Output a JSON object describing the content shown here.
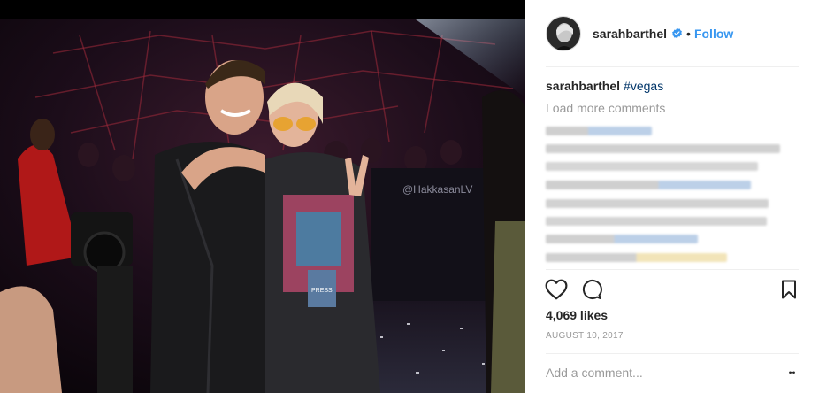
{
  "post": {
    "username": "sarahbarthel",
    "separator": "•",
    "follow_label": "Follow",
    "caption_user": "sarahbarthel",
    "caption_tag": "#vegas",
    "load_more": "Load more comments",
    "likes": "4,069 likes",
    "date": "AUGUST 10, 2017",
    "comment_placeholder": "Add a comment...",
    "more_options": "•••",
    "photo_sign_text": "@HakkasanLV",
    "photo_badge_text": "PRESS"
  },
  "icons": {
    "verified": "verified-badge-icon",
    "like": "heart-icon",
    "comment": "comment-bubble-icon",
    "save": "bookmark-icon"
  },
  "colors": {
    "follow": "#3897f0",
    "verified": "#3897f0",
    "hashtag": "#003569",
    "muted": "#999999",
    "text": "#262626",
    "divider": "#efefef"
  }
}
